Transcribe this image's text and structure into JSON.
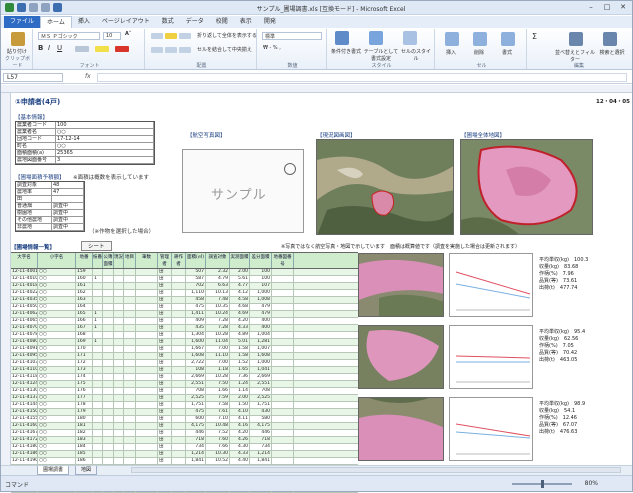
{
  "window": {
    "title": "サンプル_圃場調書.xls [互換モード] - Microsoft Excel",
    "controls": [
      "–",
      "□",
      "✕"
    ]
  },
  "ribbon_tabs": [
    "ファイル",
    "ホーム",
    "挿入",
    "ページレイアウト",
    "数式",
    "データ",
    "校閲",
    "表示",
    "開発"
  ],
  "ribbon": {
    "paste_label": "貼り付け",
    "clipboard_label": "クリップボード",
    "font_name": "ＭＳ Ｐゴシック",
    "font_size": "10",
    "font_label": "フォント",
    "alignment_label": "配置",
    "wrap_text": "折り返して全体を表示する",
    "merge_center": "セルを結合して中央揃え",
    "number_format": "標準",
    "number_label": "数値",
    "cond_format": "条件付き書式",
    "table_format": "テーブルとして書式設定",
    "cell_styles": "セルのスタイル",
    "styles_label": "スタイル",
    "insert": "挿入",
    "delete": "削除",
    "format": "書式",
    "cells_label": "セル",
    "sort_filter": "並べ替えとフィルター",
    "find_select": "検索と選択",
    "editing_label": "編集"
  },
  "formula_bar": {
    "name_box": "L57",
    "fx": "fx",
    "content": ""
  },
  "sheet": {
    "title": "①申請者(4戸)",
    "date": "12・04・05",
    "section_basic": "【基本情報】",
    "section_aerial": "【航空写真図】",
    "section_current": "【現況図画図】",
    "section_map": "【圃場全体地図】",
    "section_farm": "【圃場面積予積額】",
    "section_cultivation": "【耕作者数】",
    "note_farm": "※面積は概数を表示しています",
    "note_pressure": "（※作物を選択した場合）",
    "sample_text": "サンプル",
    "basic_rows": [
      [
        "農業者コード",
        "100"
      ],
      [
        "農業者名",
        "○○"
      ],
      [
        "団地コード",
        "17-12-14"
      ],
      [
        "町名",
        "○○"
      ],
      [
        "面積面積(a)",
        "25365"
      ],
      [
        "農地図面番号",
        "3"
      ]
    ],
    "farm_rows": [
      [
        "調査対象",
        "48"
      ],
      [
        "農地率",
        "47"
      ],
      [
        "田",
        ""
      ],
      [
        "普通畑",
        "調査中"
      ],
      [
        "樹園地",
        "調査中"
      ],
      [
        "その他農地",
        "調査中"
      ],
      [
        "非農地",
        "調査中"
      ]
    ],
    "section_table": "【圃場情報一覧】",
    "table_tab": "シート",
    "notice": "※写真ではなく航空写真・地図で示しています　面積は概算値です（調査を実施した場合は更新されます）",
    "table_headers": [
      "大字名",
      "小字名",
      "地番",
      "枝番",
      "公簿面積",
      "現況",
      "地目",
      "筆数",
      "管理者",
      "耕作者",
      "面積(㎡)",
      "調査対象",
      "実測面積",
      "差分面積",
      "地番図番号"
    ],
    "table_rows": [
      [
        "12-11-4001",
        "○○",
        "159",
        "",
        "",
        "",
        "",
        "",
        "田",
        "",
        "507",
        "2.32",
        "2.00",
        "100"
      ],
      [
        "12-11-4010",
        "○○",
        "160",
        "1",
        "",
        "",
        "",
        "",
        "田",
        "",
        "587",
        "4.79",
        "5.61",
        "100"
      ],
      [
        "12-11-4018",
        "○○",
        "161",
        "",
        "",
        "",
        "",
        "",
        "田",
        "",
        "702",
        "6.63",
        "4.77",
        "107"
      ],
      [
        "12-11-4022",
        "○○",
        "162",
        "",
        "",
        "",
        "",
        "",
        "田",
        "",
        "1,110",
        "10.13",
        "4.12",
        "1,000"
      ],
      [
        "12-11-4035",
        "○○",
        "163",
        "",
        "",
        "",
        "",
        "",
        "田",
        "",
        "458",
        "7.48",
        "4.58",
        "1,008"
      ],
      [
        "12-11-4050",
        "○○",
        "164",
        "",
        "",
        "",
        "",
        "",
        "田",
        "",
        "475",
        "10.35",
        "4.68",
        "479"
      ],
      [
        "12-11-4062",
        "○○",
        "165",
        "1",
        "",
        "",
        "",
        "",
        "田",
        "",
        "1,411",
        "10.24",
        "4.69",
        "479"
      ],
      [
        "12-11-4065",
        "○○",
        "166",
        "1",
        "",
        "",
        "",
        "",
        "田",
        "",
        "409",
        "7.28",
        "4.20",
        "400"
      ],
      [
        "12-11-4070",
        "○○",
        "167",
        "1",
        "",
        "",
        "",
        "",
        "田",
        "",
        "435",
        "7.28",
        "4.33",
        "400"
      ],
      [
        "12-11-4078",
        "○○",
        "168",
        "",
        "",
        "",
        "",
        "",
        "田",
        "",
        "1,304",
        "10.28",
        "4.89",
        "1,004"
      ],
      [
        "12-11-4080",
        "○○",
        "169",
        "1",
        "",
        "",
        "",
        "",
        "田",
        "",
        "1,600",
        "11.04",
        "5.01",
        "1,281"
      ],
      [
        "12-11-4091",
        "○○",
        "170",
        "",
        "",
        "",
        "",
        "",
        "田",
        "",
        "1,667",
        "7.00",
        "1.58",
        "1,007"
      ],
      [
        "12-11-4095",
        "○○",
        "171",
        "",
        "",
        "",
        "",
        "",
        "田",
        "",
        "1,608",
        "11.10",
        "1.58",
        "1,608"
      ],
      [
        "12-11-4103",
        "○○",
        "172",
        "",
        "",
        "",
        "",
        "",
        "田",
        "",
        "2,722",
        "7.00",
        "1.52",
        "1,000"
      ],
      [
        "12-11-4110",
        "○○",
        "173",
        "",
        "",
        "",
        "",
        "",
        "田",
        "",
        "108",
        "1.18",
        "1.65",
        "1,041"
      ],
      [
        "12-11-4118",
        "○○",
        "174",
        "",
        "",
        "",
        "",
        "",
        "田",
        "",
        "2,669",
        "10.28",
        "7.36",
        "2,669"
      ],
      [
        "12-11-4124",
        "○○",
        "175",
        "",
        "",
        "",
        "",
        "",
        "田",
        "",
        "2,551",
        "7.50",
        "1.24",
        "2,551"
      ],
      [
        "12-11-4130",
        "○○",
        "176",
        "",
        "",
        "",
        "",
        "",
        "田",
        "",
        "708",
        "1.66",
        "1.14",
        "708"
      ],
      [
        "12-11-4137",
        "○○",
        "177",
        "",
        "",
        "",
        "",
        "",
        "田",
        "",
        "2,525",
        "7.59",
        "2.00",
        "2,525"
      ],
      [
        "12-11-4144",
        "○○",
        "178",
        "",
        "",
        "",
        "",
        "",
        "田",
        "",
        "1,751",
        "7.58",
        "1.50",
        "1,751"
      ],
      [
        "12-11-4150",
        "○○",
        "179",
        "",
        "",
        "",
        "",
        "",
        "田",
        "",
        "475",
        "7.61",
        "4.10",
        "430"
      ],
      [
        "12-11-4155",
        "○○",
        "180",
        "",
        "",
        "",
        "",
        "",
        "田",
        "",
        "600",
        "7.10",
        "4.11",
        "580"
      ],
      [
        "12-11-4160",
        "○○",
        "181",
        "",
        "",
        "",
        "",
        "",
        "田",
        "",
        "4,175",
        "10.48",
        "4.16",
        "4,175"
      ],
      [
        "12-11-4167",
        "○○",
        "182",
        "",
        "",
        "",
        "",
        "",
        "田",
        "",
        "446",
        "7.52",
        "4.20",
        "446"
      ],
      [
        "12-11-4172",
        "○○",
        "183",
        "",
        "",
        "",
        "",
        "",
        "田",
        "",
        "718",
        "7.60",
        "4.26",
        "718"
      ],
      [
        "12-11-4180",
        "○○",
        "184",
        "",
        "",
        "",
        "",
        "",
        "田",
        "",
        "734",
        "7.66",
        "4.30",
        "734"
      ],
      [
        "12-11-4186",
        "○○",
        "185",
        "",
        "",
        "",
        "",
        "",
        "田",
        "",
        "1,214",
        "10.30",
        "4.33",
        "1,214"
      ],
      [
        "12-11-4190",
        "○○",
        "186",
        "",
        "",
        "",
        "",
        "",
        "田",
        "",
        "1,841",
        "10.52",
        "4.40",
        "1,841"
      ],
      [
        "12-11-4198",
        "○○",
        "187",
        "",
        "",
        "",
        "",
        "",
        "田",
        "",
        "1,363",
        "7.57",
        "4.42",
        "1,363"
      ],
      [
        "12-11-4204",
        "○○",
        "188",
        "",
        "",
        "",
        "",
        "",
        "田",
        "",
        "559",
        "7.60",
        "4.45",
        "559"
      ],
      [
        "12-11-4211",
        "○○",
        "189",
        "",
        "",
        "",
        "",
        "",
        "田",
        "",
        "612",
        "7.62",
        "4.48",
        "612"
      ],
      [
        "12-11-4218",
        "○○",
        "190",
        "",
        "",
        "",
        "",
        "",
        "田",
        "",
        "773",
        "7.65",
        "4.50",
        "773"
      ]
    ],
    "right_info": [
      {
        "rows": [
          [
            "平均単収(kg)",
            "100.3"
          ],
          [
            "収量(kg)",
            "83.68"
          ],
          [
            "作柄(%)",
            "7.96"
          ],
          [
            "品質(等)",
            "73.61"
          ],
          [
            "出荷(t)",
            "477.74"
          ]
        ]
      },
      {
        "rows": [
          [
            "平均単収(kg)",
            "95.4"
          ],
          [
            "収量(kg)",
            "62.56"
          ],
          [
            "作柄(%)",
            "7.05"
          ],
          [
            "品質(等)",
            "70.42"
          ],
          [
            "出荷(t)",
            "463.05"
          ]
        ]
      },
      {
        "rows": [
          [
            "平均単収(kg)",
            "98.9"
          ],
          [
            "収量(kg)",
            "54.1"
          ],
          [
            "作柄(%)",
            "12.46"
          ],
          [
            "品質(等)",
            "67.07"
          ],
          [
            "出荷(t)",
            "476.63"
          ]
        ]
      }
    ]
  },
  "sheet_tabs": [
    "圃場調書",
    "地図"
  ],
  "status": {
    "ready": "コマンド",
    "zoom": "80%"
  },
  "colors": {
    "accent": "#2e6bc4",
    "header_green": "#cfeccd",
    "title_blue": "#1b3f80",
    "map_pink": "#e49ac0"
  }
}
